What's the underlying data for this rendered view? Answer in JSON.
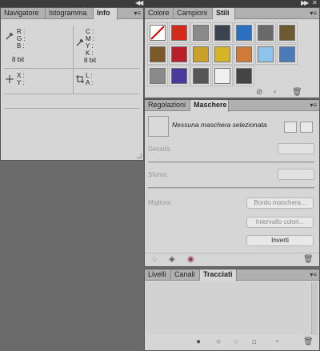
{
  "info_panel": {
    "tabs": [
      "Navigatore",
      "Istogramma",
      "Info"
    ],
    "active_tab": "Info",
    "rgb_labels": [
      "R :",
      "G :",
      "B :"
    ],
    "cmyk_labels": [
      "C :",
      "M :",
      "Y :",
      "K :"
    ],
    "bit_left": "8 bit",
    "bit_right": "8 bit",
    "xy_labels": [
      "X :",
      "Y :"
    ],
    "la_labels": [
      "L :",
      "A :"
    ]
  },
  "styles_panel": {
    "tabs": [
      "Colore",
      "Campioni",
      "Stili"
    ],
    "active_tab": "Stili",
    "style_swatches": [
      {
        "name": "none",
        "color": "#ffffff"
      },
      {
        "name": "red-glow",
        "color": "#d42a1a"
      },
      {
        "name": "grey-bevel",
        "color": "#8a8a8a"
      },
      {
        "name": "dark-chrome",
        "color": "#3a4350"
      },
      {
        "name": "blue-glass",
        "color": "#2a6fc2"
      },
      {
        "name": "grey-gradient",
        "color": "#6a6a6a"
      },
      {
        "name": "bronze",
        "color": "#6e5a30"
      },
      {
        "name": "brown-bevel",
        "color": "#7a5a28"
      },
      {
        "name": "red-gloss",
        "color": "#b81e2a"
      },
      {
        "name": "rainbow",
        "color": "#c9a12a"
      },
      {
        "name": "gold",
        "color": "#d6b425"
      },
      {
        "name": "orange-gradient",
        "color": "#d07a3a"
      },
      {
        "name": "light-blue",
        "color": "#8ec3ea"
      },
      {
        "name": "sky",
        "color": "#4a7ab8"
      },
      {
        "name": "texture",
        "color": "#8a8a8a"
      },
      {
        "name": "purple-shadow",
        "color": "#4a3a9a"
      },
      {
        "name": "dark-grey",
        "color": "#555555"
      },
      {
        "name": "white-frame",
        "color": "#f0f0f0"
      },
      {
        "name": "dark-grey-2",
        "color": "#444444"
      }
    ]
  },
  "masks_panel": {
    "tabs": [
      "Regolazioni",
      "Maschere"
    ],
    "active_tab": "Maschere",
    "status": "Nessuna maschera selezionata",
    "density_label": "Densità:",
    "feather_label": "Sfuma:",
    "refine_label": "Migliora:",
    "btn_mask_edge": "Bordo maschera...",
    "btn_color_range": "Intervallo colori...",
    "btn_invert": "Inverti"
  },
  "paths_panel": {
    "tabs": [
      "Livelli",
      "Canali",
      "Tracciati"
    ],
    "active_tab": "Tracciati"
  }
}
